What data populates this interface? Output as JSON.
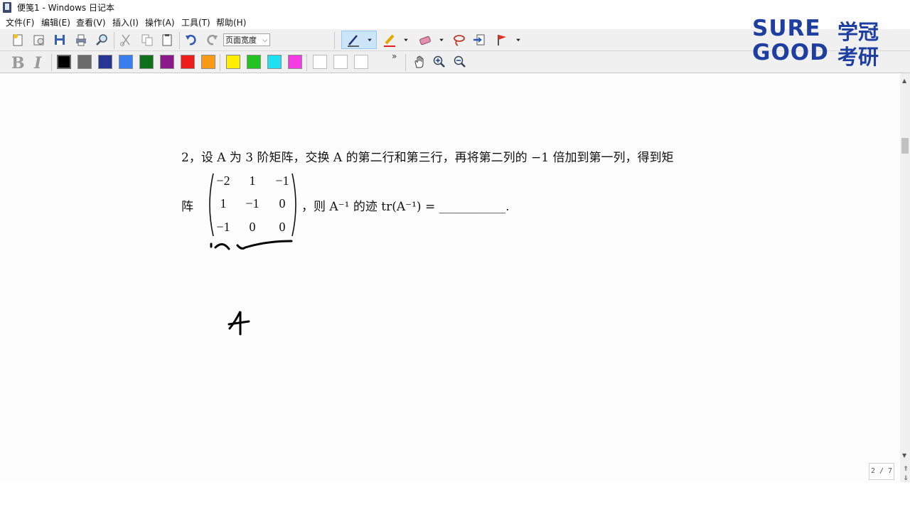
{
  "window": {
    "title": "便笺1 - Windows 日记本"
  },
  "menu": [
    "文件(F)",
    "编辑(E)",
    "查看(V)",
    "插入(I)",
    "操作(A)",
    "工具(T)",
    "帮助(H)"
  ],
  "toolbar": {
    "zoom_value": "页面宽度",
    "more_glyph": "»"
  },
  "format": {
    "bold": "B",
    "italic": "I"
  },
  "colors": [
    "#000000",
    "#6b6b6b",
    "#283593",
    "#3a7ff0",
    "#11711a",
    "#8a1a8a",
    "#ee1c1c",
    "#f79a16",
    "#ffee00",
    "#22c322",
    "#1fe0f0",
    "#f23be0",
    "#ffffff",
    "#ffffff",
    "#ffffff"
  ],
  "brand": {
    "line1": "SURE",
    "line2": "GOOD",
    "cn1": "学冠",
    "cn2": "考研"
  },
  "question": {
    "line1": "2，设 A 为 3 阶矩阵，交换 A 的第二行和第三行，再将第二列的 −1 倍加到第一列，得到矩",
    "lead": "阵",
    "tail": "，则 A⁻¹ 的迹 tr(A⁻¹) = ___________.",
    "matrix": [
      [
        "−2",
        "1",
        "−1"
      ],
      [
        "1",
        "−1",
        "0"
      ],
      [
        "−1",
        "0",
        "0"
      ]
    ]
  },
  "handwriting": {
    "note": "A"
  },
  "pager": {
    "label": "2 / 7"
  }
}
